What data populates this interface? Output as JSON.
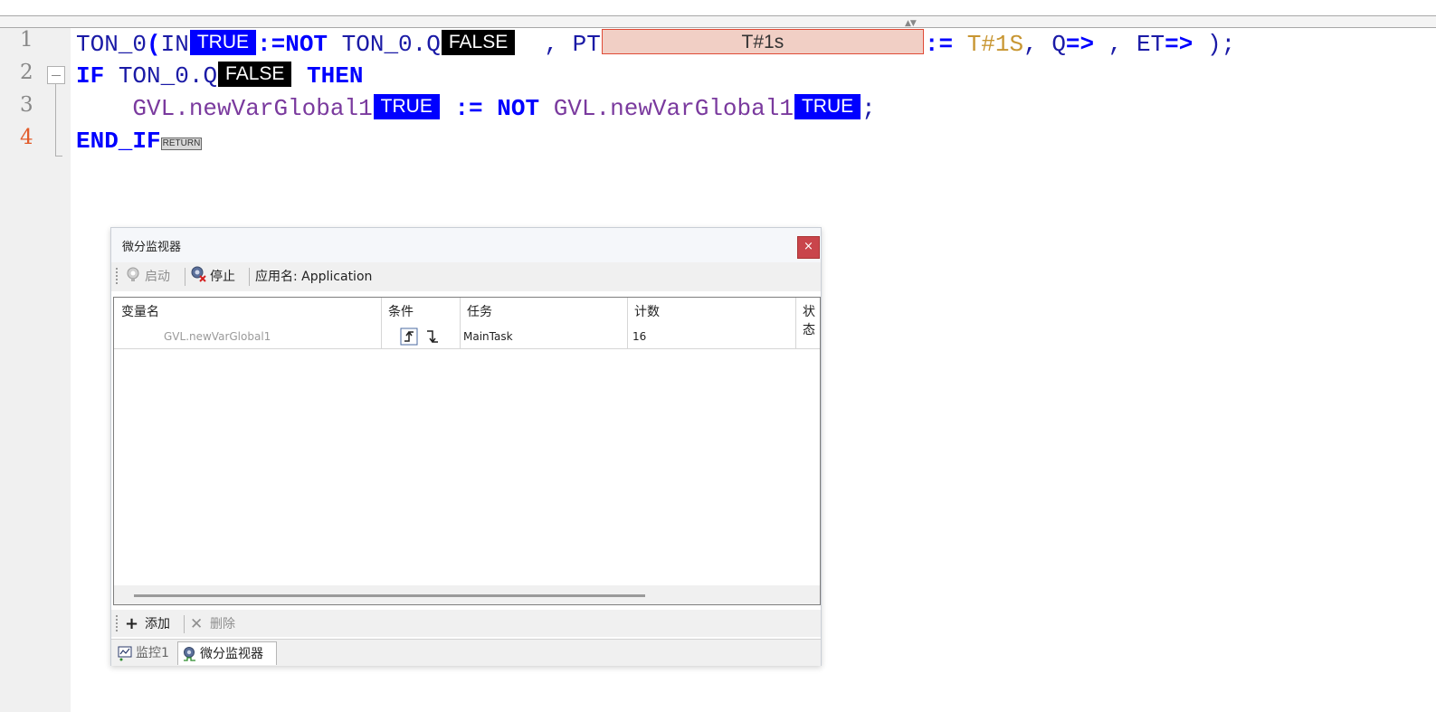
{
  "editor": {
    "line_numbers": [
      "1",
      "2",
      "3",
      "4"
    ],
    "line1": {
      "ton0": "TON_0",
      "paren_open": "(",
      "in_kw": "IN",
      "in_value": "TRUE",
      "assign_not": ":=NOT",
      "ton0_q": "TON_0.Q",
      "q_value": "FALSE",
      "comma_pt": "  , PT",
      "pt_value": "T#1s",
      "assign": ":=",
      "time_literal": "T#1S",
      "comma_q": ", Q",
      "arrow1": "=>",
      "comma_et": " , ET",
      "arrow2": "=>",
      "close": " );"
    },
    "line2": {
      "if_kw": "IF",
      "cond": "TON_0.Q",
      "cond_value": "FALSE",
      "then_kw": "THEN"
    },
    "line3": {
      "indent": "    ",
      "target": "GVL.newVarGlobal1",
      "target_value": "TRUE",
      "assign": ":=",
      "not_kw": "NOT",
      "source": "GVL.newVarGlobal1",
      "source_value": "TRUE",
      "semicolon": ";"
    },
    "line4": {
      "end_if": "END_IF",
      "return_marker": "RETURN"
    }
  },
  "panel": {
    "title": "微分监视器",
    "close_glyph": "×",
    "toolbar": {
      "start_label": "启动",
      "stop_label": "停止",
      "app_label": "应用名: Application"
    },
    "grid": {
      "headers": [
        "变量名",
        "条件",
        "任务",
        "计数",
        "状态"
      ],
      "rows": [
        {
          "variable": "GVL.newVarGlobal1",
          "task": "MainTask",
          "count": "16"
        }
      ]
    },
    "bottom_toolbar": {
      "add_label": "添加",
      "delete_label": "删除"
    },
    "tabs": [
      {
        "label": "监控1",
        "icon": "watch-icon"
      },
      {
        "label": "微分监视器",
        "icon": "differential-monitor-icon"
      }
    ]
  },
  "colors": {
    "monitor_true": "#0000ff",
    "monitor_false": "#000000",
    "keyword": "#0000ff",
    "global_var": "#7a3a9e",
    "time_literal": "#c89632",
    "time_box_bg": "#f1cfc5",
    "close_button": "#c9454b"
  }
}
